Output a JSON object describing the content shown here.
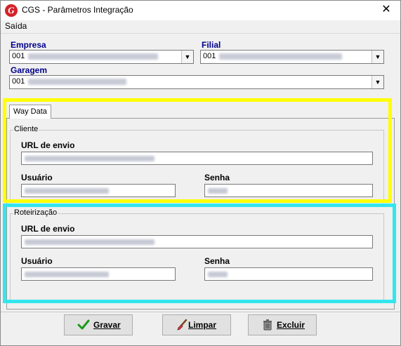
{
  "window": {
    "title": "CGS - Parâmetros Integração",
    "close_glyph": "✕",
    "app_icon_letter": "G",
    "app_icon_color": "#d2232a"
  },
  "menu": {
    "items": [
      {
        "label": "Saída"
      }
    ]
  },
  "form": {
    "empresa": {
      "label": "Empresa",
      "value": "001"
    },
    "filial": {
      "label": "Filial",
      "value": "001"
    },
    "garagem": {
      "label": "Garagem",
      "value": "001"
    }
  },
  "tabs": [
    {
      "label": "Way Data",
      "selected": true
    }
  ],
  "cliente": {
    "group_title": "Cliente",
    "url_label": "URL de envio",
    "usuario_label": "Usuário",
    "senha_label": "Senha"
  },
  "roteirizacao": {
    "group_title": "Roteirização",
    "url_label": "URL de envio",
    "usuario_label": "Usuário",
    "senha_label": "Senha"
  },
  "buttons": {
    "gravar": {
      "label": "Gravar",
      "icon": "checkmark-icon"
    },
    "limpar": {
      "label": "Limpar",
      "icon": "brush-icon"
    },
    "excluir": {
      "label": "Excluir",
      "icon": "trash-icon"
    }
  },
  "highlights": {
    "yellow": "#ffff00",
    "cyan": "#33e6ee"
  }
}
